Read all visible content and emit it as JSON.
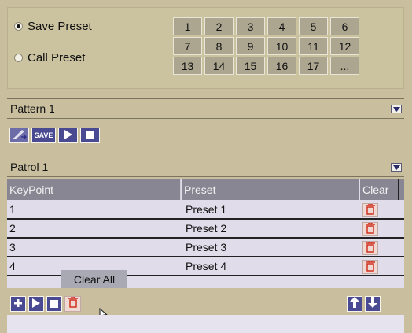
{
  "preset": {
    "save_label": "Save Preset",
    "call_label": "Call Preset",
    "selected": "save",
    "numbers": [
      "1",
      "2",
      "3",
      "4",
      "5",
      "6",
      "7",
      "8",
      "9",
      "10",
      "11",
      "12",
      "13",
      "14",
      "15",
      "16",
      "17",
      "..."
    ]
  },
  "pattern": {
    "title": "Pattern 1",
    "save_label": "SAVE"
  },
  "patrol": {
    "title": "Patrol 1",
    "columns": [
      "KeyPoint",
      "Preset",
      "Clear"
    ],
    "rows": [
      {
        "keypoint": "1",
        "preset": "Preset 1"
      },
      {
        "keypoint": "2",
        "preset": "Preset 2"
      },
      {
        "keypoint": "3",
        "preset": "Preset 3"
      },
      {
        "keypoint": "4",
        "preset": "Preset 4"
      }
    ],
    "tooltip": "Clear All"
  },
  "colors": {
    "panel_bg": "#c9bf9f",
    "button_blue": "#4a4a92",
    "trash_red": "#d03020",
    "table_header": "#888693",
    "table_bg": "#e0dce9"
  }
}
